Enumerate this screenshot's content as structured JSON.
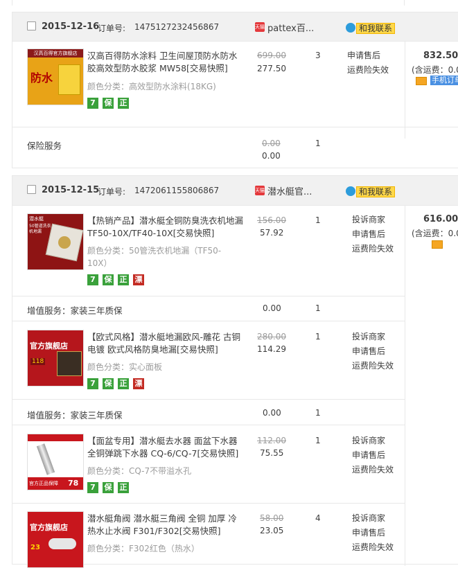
{
  "top_divider": true,
  "orders": [
    {
      "date": "2015-12-16",
      "order_label": "订单号:",
      "order_no": "1475127232456867",
      "shop_badge": "天猫",
      "shop": "pattex百...",
      "contact": "和我联系",
      "total": "832.50",
      "shipping": "(含运费：0.0",
      "mobile": "手机订单",
      "items": [
        {
          "title": "汉高百得防水涂料 卫生间屋顶防水防水胶高效型防水胶浆 MW58[交易快照]",
          "spec_label": "颜色分类：",
          "spec": "高效型防水涂料(18KG)",
          "old_price": "699.00",
          "price": "277.50",
          "qty": "3",
          "ops": [
            "申请售后",
            "运费险失效"
          ],
          "icons": [
            "7",
            "保",
            "正"
          ],
          "thumb_top": "汉高百得官方旗舰店",
          "thumb_main": "防水"
        }
      ],
      "service": {
        "label": "保险服务",
        "old_price": "0.00",
        "price": "0.00",
        "qty": "1"
      }
    },
    {
      "date": "2015-12-15",
      "order_label": "订单号:",
      "order_no": "1472061155806867",
      "shop_badge": "天猫",
      "shop": "潜水艇官...",
      "contact": "和我联系",
      "total": "616.00",
      "shipping": "(含运费：0.0",
      "items": [
        {
          "title": "【热销产品】潜水艇全铜防臭洗衣机地漏TF50-10X/TF40-10X[交易快照]",
          "spec_label": "颜色分类：",
          "spec": "50管洗衣机地漏（TF50-10X）",
          "old_price": "156.00",
          "price": "57.92",
          "qty": "1",
          "ops": [
            "投诉商家",
            "申请售后",
            "运费险失效"
          ],
          "icons": [
            "7",
            "保",
            "正",
            "漂"
          ],
          "thumb_top": "潜水艇",
          "thumb_main": "50管道洗衣机地漏",
          "service_label": "增值服务：家装三年质保",
          "service_price": "0.00",
          "service_qty": "1"
        },
        {
          "title": "【欧式风格】潜水艇地漏欧风-雕花 古铜电镀 欧式风格防臭地漏[交易快照]",
          "spec_label": "颜色分类：",
          "spec": "实心面板",
          "old_price": "280.00",
          "price": "114.29",
          "qty": "1",
          "ops": [
            "投诉商家",
            "申请售后",
            "运费险失效"
          ],
          "icons": [
            "7",
            "保",
            "正",
            "漂"
          ],
          "thumb_top": "官方旗舰店",
          "thumb_main": "118",
          "service_label": "增值服务：家装三年质保",
          "service_price": "0.00",
          "service_qty": "1"
        },
        {
          "title": "【面盆专用】潜水艇去水器 面盆下水器全铜弹跳下水器 CQ-6/CQ-7[交易快照]",
          "spec_label": "颜色分类：",
          "spec": "CQ-7不带溢水孔",
          "old_price": "112.00",
          "price": "75.55",
          "qty": "1",
          "ops": [
            "投诉商家",
            "申请售后",
            "运费险失效"
          ],
          "icons": [
            "7",
            "保",
            "正"
          ],
          "thumb_top": "官方正品保障",
          "thumb_main": "78"
        },
        {
          "title": "潜水艇角阀 潜水艇三角阀 全铜 加厚 冷热水止水阀 F301/F302[交易快照]",
          "spec_label": "颜色分类：",
          "spec": "F302红色（热水）",
          "old_price": "58.00",
          "price": "23.05",
          "qty": "4",
          "ops": [
            "投诉商家",
            "申请售后",
            "运费险失效"
          ],
          "icons": [],
          "thumb_top": "官方旗舰店",
          "thumb_main": "23"
        }
      ]
    }
  ]
}
